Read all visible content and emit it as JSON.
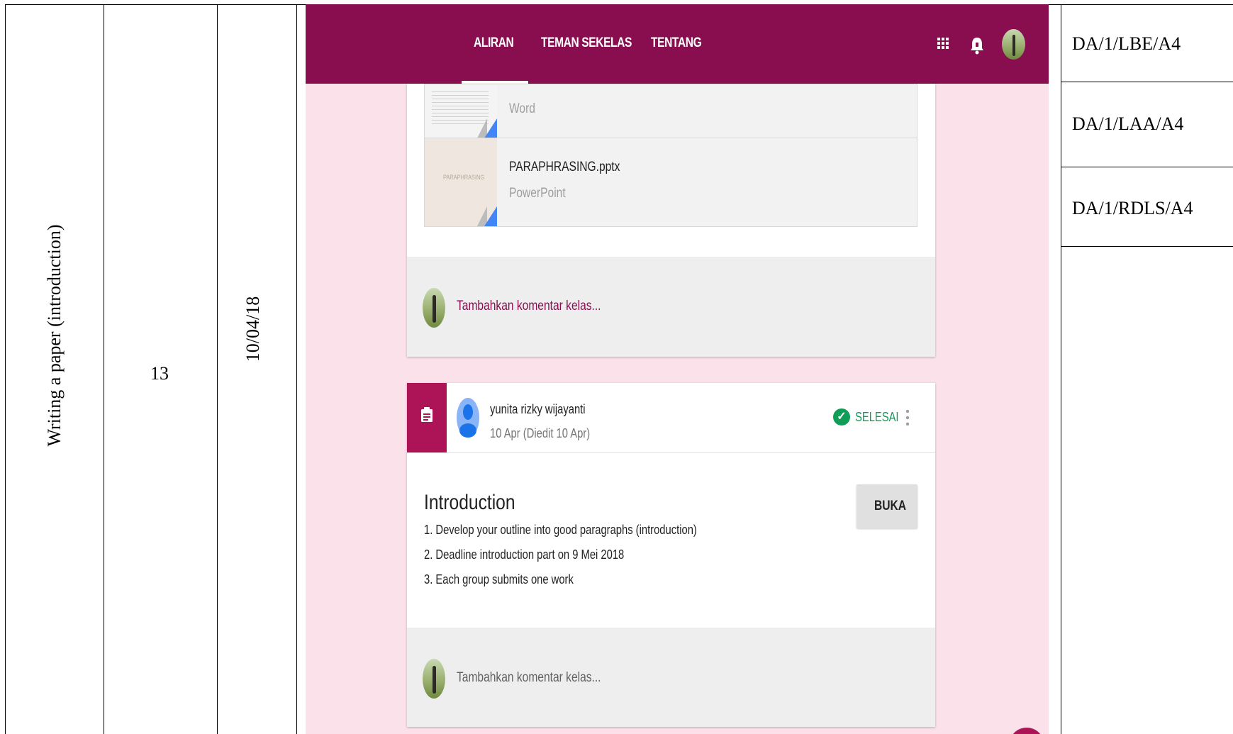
{
  "table": {
    "topic": "Writing a paper (introduction)",
    "meeting": "13",
    "date": "10/04/18",
    "codes": [
      "DA/1/LBE/A4",
      "DA/1/LAA/A4",
      "DA/1/RDLS/A4"
    ]
  },
  "classroom": {
    "tabs": [
      "ALIRAN",
      "TEMAN SEKELAS",
      "TENTANG"
    ],
    "attachments": [
      {
        "name": "",
        "type": "Word"
      },
      {
        "name": "PARAPHRASING.pptx",
        "type": "PowerPoint",
        "thumb_text": "PARAPHRASING"
      }
    ],
    "comment_placeholder": "Tambahkan komentar kelas...",
    "post": {
      "author": "yunita rizky wijayanti",
      "date": "10 Apr (Diedit 10 Apr)",
      "status": "SELESAI",
      "title": "Introduction",
      "items": [
        "1. Develop your outline into good paragraphs (introduction)",
        "2. Deadline introduction part on 9 Mei 2018",
        "3. Each group submits one work"
      ],
      "open_button": "BUKA"
    },
    "colors": {
      "header": "#880e4f",
      "background": "#fbe1ea",
      "accent": "#ad1457",
      "done": "#0f9d58"
    }
  }
}
